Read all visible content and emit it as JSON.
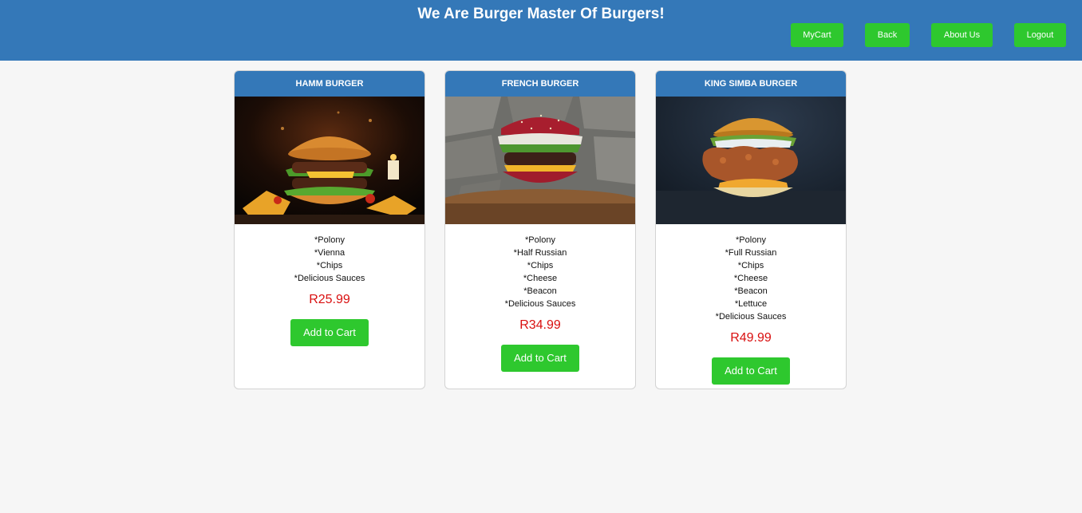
{
  "header": {
    "title": "We Are Burger Master Of Burgers!",
    "nav": {
      "mycart": "MyCart",
      "back": "Back",
      "about": "About Us",
      "logout": "Logout"
    },
    "accent_color": "#3478b8",
    "button_color": "#2ec82e"
  },
  "products": [
    {
      "name": "Hamm Burger",
      "ingredients": [
        "*Polony",
        "*Vienna",
        "*Chips",
        "*Delicious Sauces"
      ],
      "price": "R25.99",
      "button": "Add to Cart"
    },
    {
      "name": "French Burger",
      "ingredients": [
        "*Polony",
        "*Half Russian",
        "*Chips",
        "*Cheese",
        "*Beacon",
        "*Delicious Sauces"
      ],
      "price": "R34.99",
      "button": "Add to Cart"
    },
    {
      "name": "King Simba Burger",
      "ingredients": [
        "*Polony",
        "*Full Russian",
        "*Chips",
        "*Cheese",
        "*Beacon",
        "*Lettuce",
        "*Delicious Sauces"
      ],
      "price": "R49.99",
      "button": "Add to Cart"
    }
  ],
  "price_color": "#d90f0f"
}
